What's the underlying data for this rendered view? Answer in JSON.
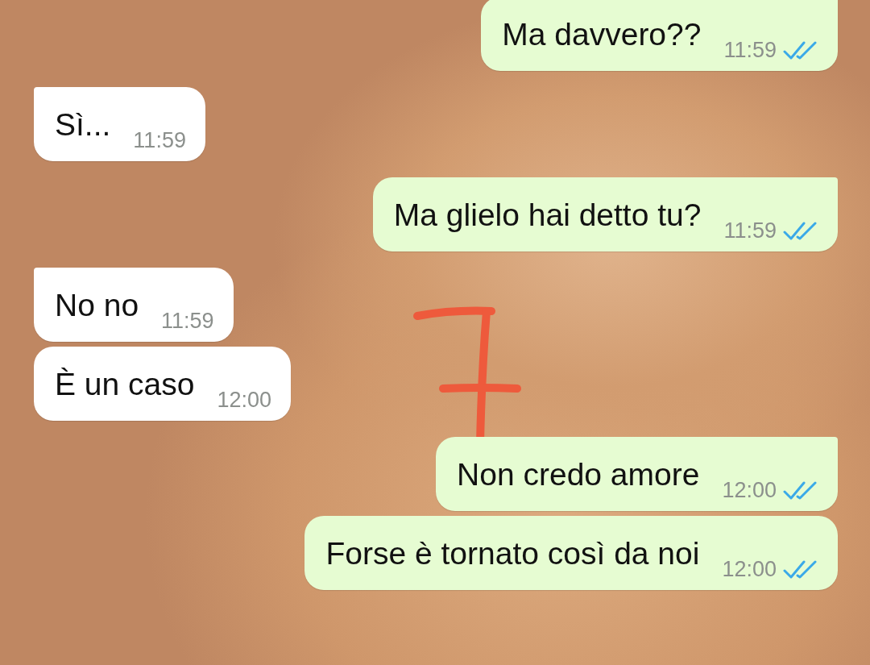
{
  "messages": [
    {
      "kind": "sent",
      "text": "Ma davvero??",
      "time": "11:59",
      "first": true,
      "read": true
    },
    {
      "kind": "received",
      "text": "Sì...",
      "time": "11:59",
      "first": true
    },
    {
      "kind": "sent",
      "text": "Ma glielo hai detto tu?",
      "time": "11:59",
      "first": true,
      "read": true
    },
    {
      "kind": "received",
      "text": "No no",
      "time": "11:59",
      "first": true
    },
    {
      "kind": "received",
      "text": "È un caso",
      "time": "12:00",
      "first": false
    },
    {
      "kind": "sent",
      "text": "Non credo amore",
      "time": "12:00",
      "first": true,
      "read": true
    },
    {
      "kind": "sent",
      "text": "Forse è tornato così da noi",
      "time": "12:00",
      "first": false,
      "read": true
    }
  ]
}
